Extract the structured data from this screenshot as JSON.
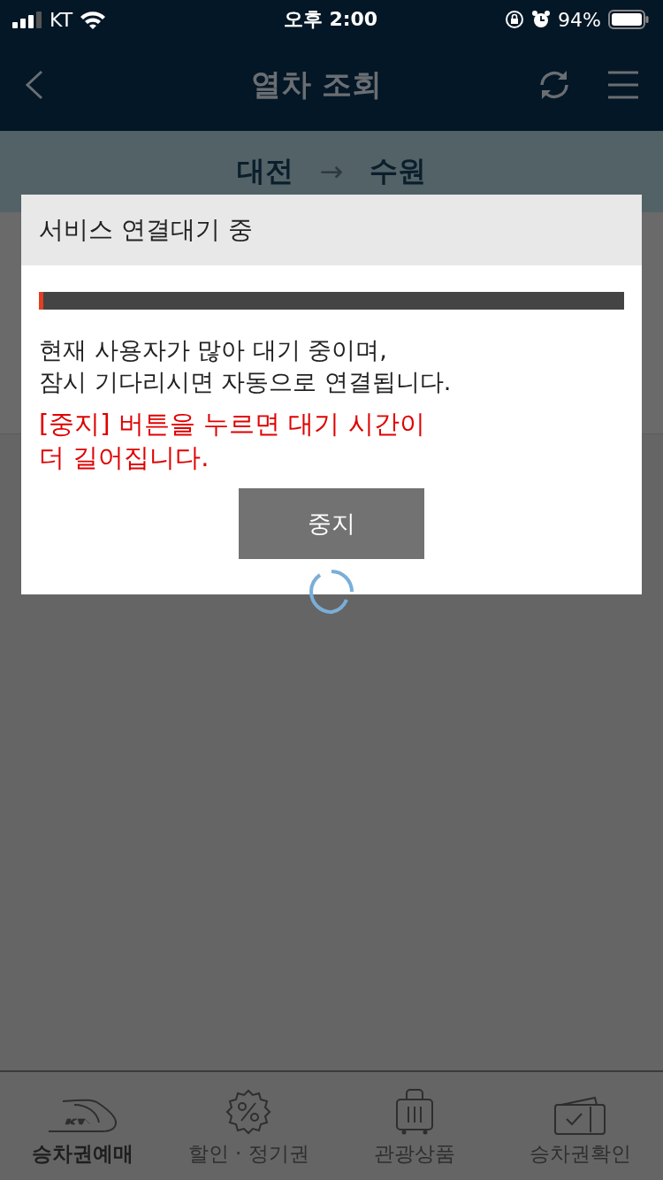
{
  "status_bar": {
    "carrier": "KT",
    "time": "오후 2:00",
    "battery": "94%"
  },
  "header": {
    "title": "열차 조회"
  },
  "route": {
    "from": "대전",
    "arrow": "→",
    "to": "수원"
  },
  "dialog": {
    "title": "서비스 연결대기 중",
    "progress": {
      "level": 0.003
    },
    "message": "현재 사용자가 많아 대기 중이며,\n잠시 기다리시면 자동으로 연결됩니다.",
    "warning": "[중지] 버튼을 누르면 대기 시간이\n더 길어집니다.",
    "button": "중지"
  },
  "tab_bar": [
    {
      "kind": "train",
      "label": "승차권예매",
      "selected": true
    },
    {
      "kind": "discount",
      "label": "할인 · 정기권",
      "selected": false
    },
    {
      "kind": "luggage",
      "label": "관광상품",
      "selected": false
    },
    {
      "kind": "ticket",
      "label": "승차권확인",
      "selected": false
    }
  ]
}
